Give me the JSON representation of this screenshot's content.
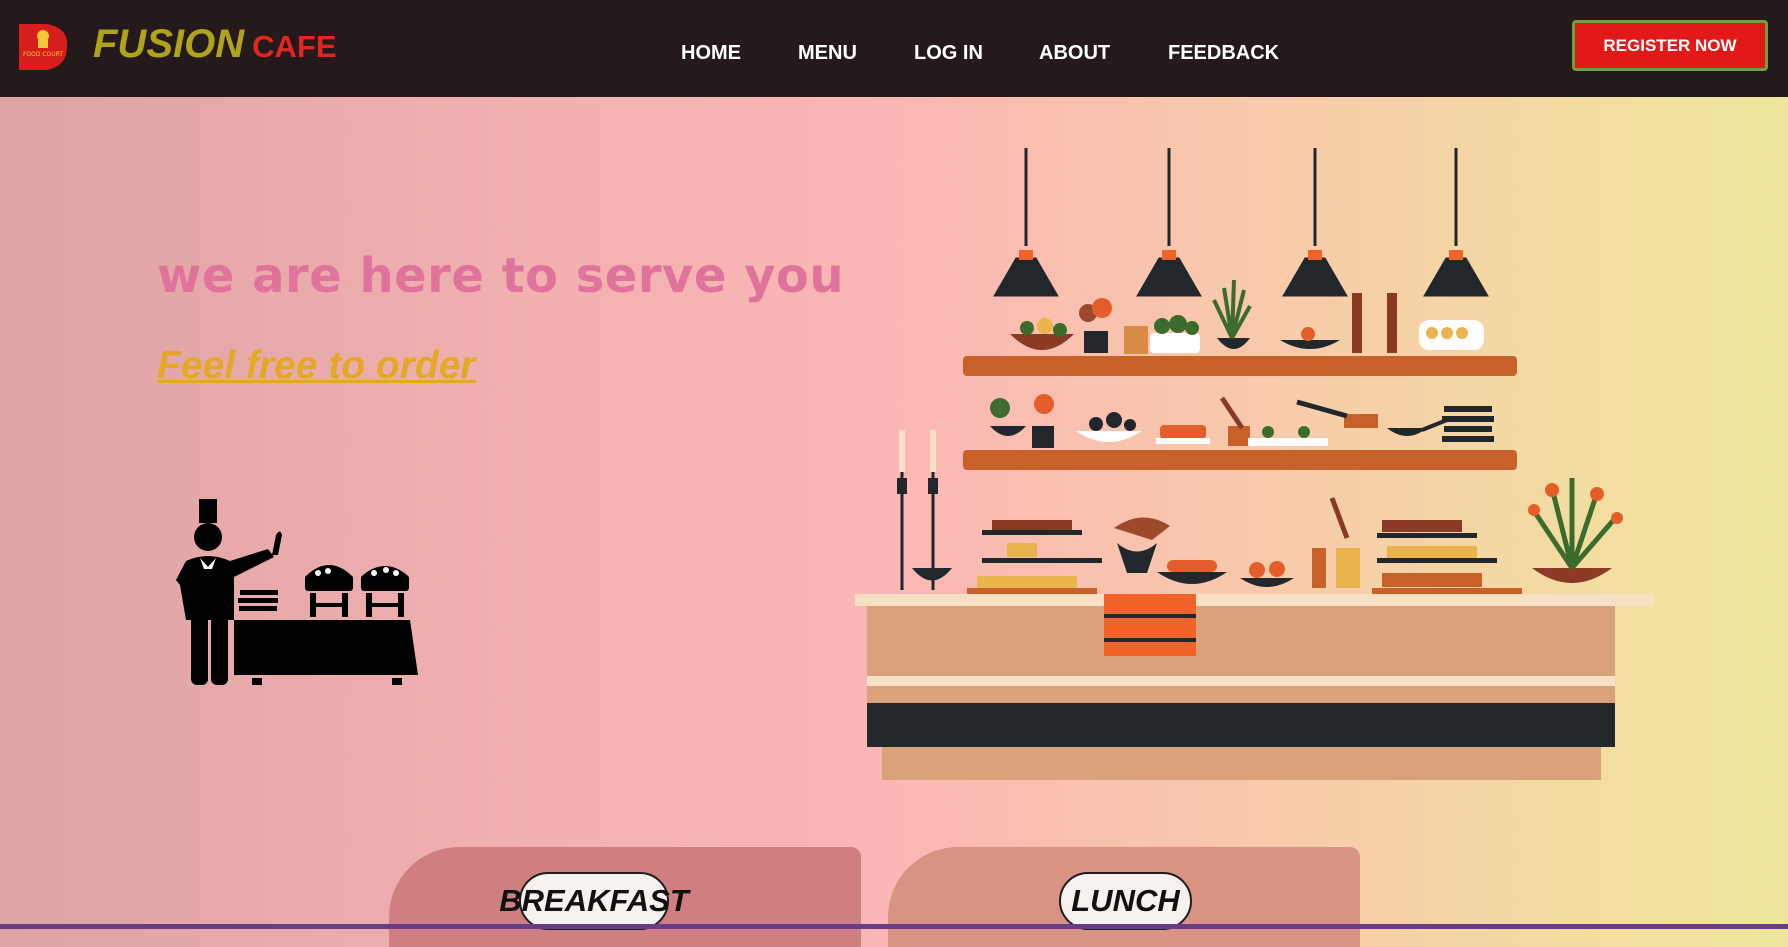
{
  "brand": {
    "name_main": "FUSION",
    "name_sub": "CAFE",
    "logo_text": "FOOD COURT"
  },
  "nav": {
    "items": [
      "HOME",
      "MENU",
      "LOG IN",
      "ABOUT",
      "FEEDBACK"
    ]
  },
  "cta_register": "REGISTER NOW",
  "hero": {
    "tagline": "we are here to serve you",
    "cta_link": "Feel free to order"
  },
  "meal_cards": [
    "BREAKFAST",
    "LUNCH"
  ],
  "colors": {
    "navbar": "#241a1b",
    "brand_main": "#b0a31c",
    "brand_sub": "#e0261e",
    "register_bg": "#e31818",
    "tagline": "#e0739c",
    "cta_link": "#e3a824"
  },
  "icons": [
    "food-court-logo-icon",
    "chef-buffet-icon",
    "buffet-counter-illustration"
  ]
}
